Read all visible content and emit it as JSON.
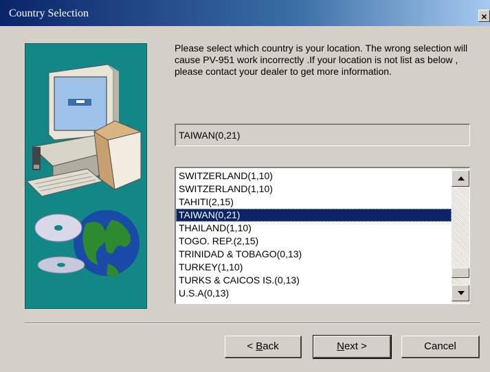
{
  "window": {
    "title": "Country Selection",
    "close_label": "×"
  },
  "intro_text": "Please select which country is your location. The wrong selection will cause PV-951 work incorrectly .If your location is not list as below , please contact your dealer to get more information.",
  "selected_country": "TAIWAN(0,21)",
  "country_list": [
    "SWITZERLAND(1,10)",
    "SWITZERLAND(1,10)",
    "TAHITI(2,15)",
    "TAIWAN(0,21)",
    "THAILAND(1,10)",
    "TOGO. REP.(2,15)",
    "TRINIDAD & TOBAGO(0,13)",
    "TURKEY(1,10)",
    "TURKS & CAICOS IS.(0,13)",
    "U.S.A(0,13)"
  ],
  "selected_index": 3,
  "buttons": {
    "back_prefix": "< ",
    "back_mnemonic": "B",
    "back_rest": "ack",
    "next_mnemonic": "N",
    "next_rest": "ext >",
    "cancel": "Cancel"
  },
  "colors": {
    "title_gradient_start": "#0a246a",
    "side_panel": "#138686",
    "selection": "#0a246a"
  },
  "icons": [
    "close-icon",
    "computer-illustration",
    "globe-cd-illustration",
    "scroll-up-icon",
    "scroll-down-icon"
  ]
}
